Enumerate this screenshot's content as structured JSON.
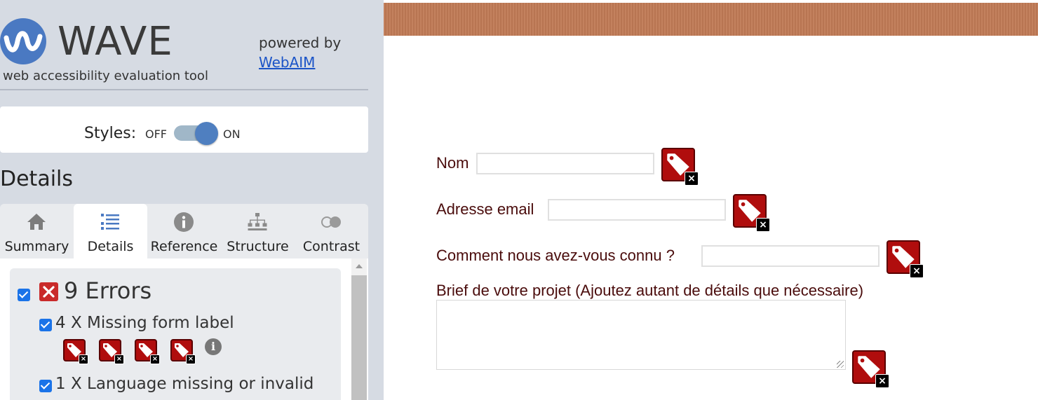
{
  "wave": {
    "logo_word": "WAVE",
    "tagline": "web accessibility evaluation tool",
    "powered_by": "powered by",
    "webaim_link": "WebAIM",
    "styles_label": "Styles:",
    "styles_off": "OFF",
    "styles_on": "ON",
    "styles_state": "on",
    "details_heading": "Details",
    "tabs": [
      {
        "label": "Summary",
        "icon": "home-icon"
      },
      {
        "label": "Details",
        "icon": "list-icon",
        "active": true
      },
      {
        "label": "Reference",
        "icon": "info-icon"
      },
      {
        "label": "Structure",
        "icon": "sitemap-icon"
      },
      {
        "label": "Contrast",
        "icon": "contrast-icon"
      }
    ],
    "errors": {
      "title": "9 Errors",
      "items": [
        {
          "label": "4 X Missing form label",
          "icon_count": 4
        },
        {
          "label": "1 X Language missing or invalid",
          "icon_count": 1
        }
      ]
    },
    "colors": {
      "sidebar_bg": "#d6dbe3",
      "error_red": "#b00d0d",
      "toggle_knob": "#4f7fc0",
      "link": "#1b54c7"
    }
  },
  "preview": {
    "fields": [
      {
        "label": "Nom"
      },
      {
        "label": "Adresse email"
      },
      {
        "label": "Comment nous avez-vous connu ?"
      }
    ],
    "brief_label": "Brief de votre projet (Ajoutez autant de détails que nécessaire)",
    "colors": {
      "banner": "#c07a55",
      "label_text": "#4a0c0c"
    }
  }
}
